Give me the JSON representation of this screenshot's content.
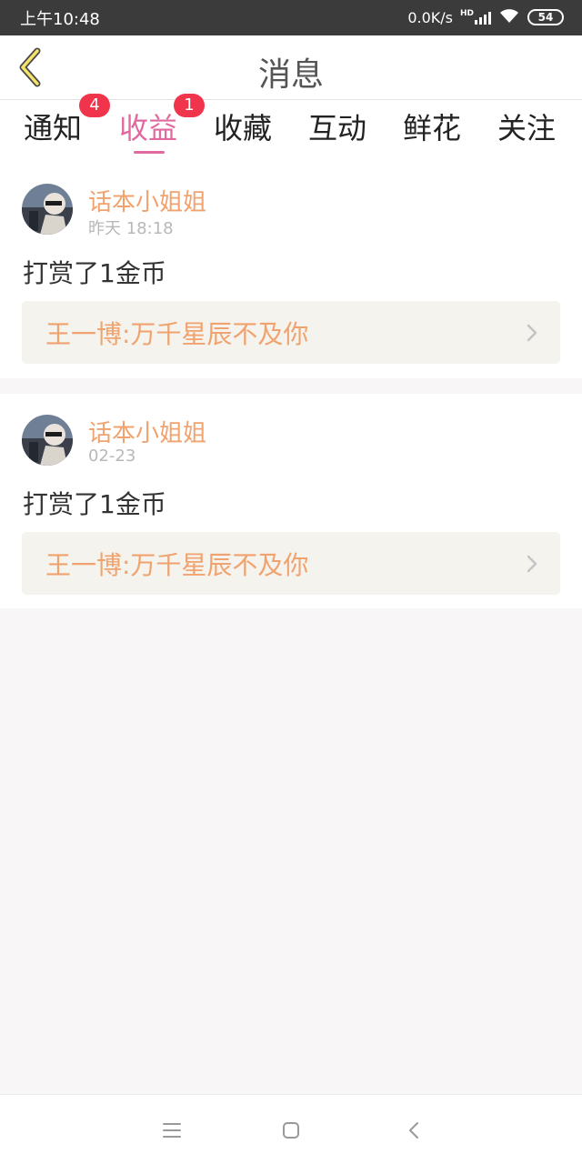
{
  "status_bar": {
    "time": "上午10:48",
    "network_speed": "0.0K/s",
    "hd_label": "HD",
    "battery": "54"
  },
  "header": {
    "title": "消息",
    "accent_color": "#f5e36a"
  },
  "tabs": [
    {
      "label": "通知",
      "badge": "4"
    },
    {
      "label": "收益",
      "badge": "1",
      "active": true
    },
    {
      "label": "收藏"
    },
    {
      "label": "互动"
    },
    {
      "label": "鲜花"
    },
    {
      "label": "关注"
    }
  ],
  "colors": {
    "active_tab": "#e06aa0",
    "badge": "#f0344c",
    "username": "#f0a36e"
  },
  "messages": [
    {
      "user": "话本小姐姐",
      "time": "昨天 18:18",
      "text": "打赏了1金币",
      "work": "王一博:万千星辰不及你"
    },
    {
      "user": "话本小姐姐",
      "time": "02-23",
      "text": "打赏了1金币",
      "work": "王一博:万千星辰不及你"
    }
  ],
  "nav": {
    "icons": [
      "menu-icon",
      "home-square-icon",
      "back-triangle-icon"
    ]
  }
}
